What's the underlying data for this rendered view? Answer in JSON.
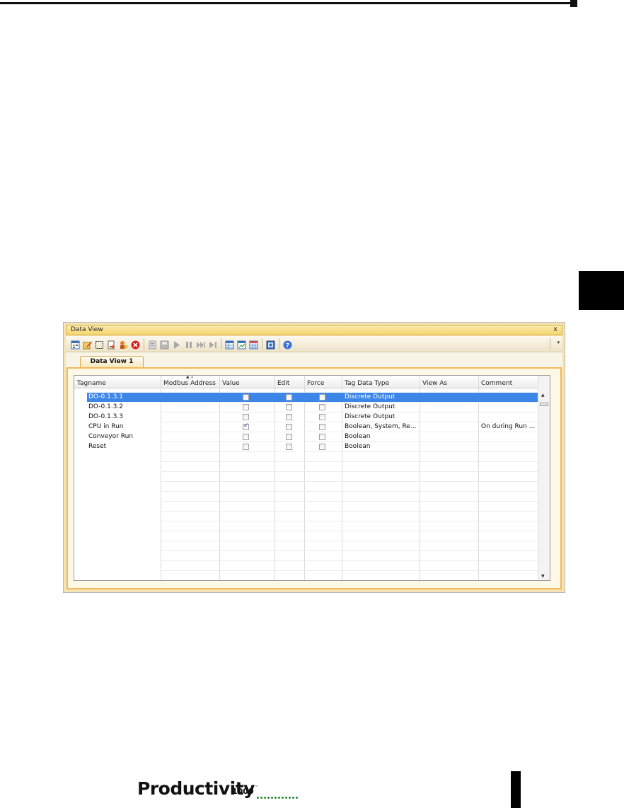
{
  "window": {
    "title": "Data View",
    "close_label": "x",
    "tab_label": "Data View 1"
  },
  "toolbar": {
    "icons": [
      "add-tag-icon",
      "edit-tag-icon",
      "select-icon",
      "import-icon",
      "user-icon",
      "remove-icon",
      "write-icon",
      "save-icon",
      "play-icon",
      "pause-icon",
      "step-forward-icon",
      "step-end-icon",
      "table-view-icon",
      "chart-view-icon",
      "grid-view-icon",
      "monitor-icon",
      "help-icon"
    ],
    "dropdown_label": "▾"
  },
  "grid": {
    "columns": [
      "Tagname",
      "Modbus Address",
      "Value",
      "Edit",
      "Force",
      "Tag Data Type",
      "View As",
      "Comment"
    ],
    "sort_indicator": "▲ 1",
    "rows": [
      {
        "tagname": "DO-0.1.3.1",
        "value_checked": false,
        "data_type": "Discrete Output",
        "comment": ""
      },
      {
        "tagname": "DO-0.1.3.2",
        "value_checked": false,
        "data_type": "Discrete Output",
        "comment": ""
      },
      {
        "tagname": "DO-0.1.3.3",
        "value_checked": false,
        "data_type": "Discrete Output",
        "comment": ""
      },
      {
        "tagname": "CPU in Run",
        "value_checked": true,
        "data_type": "Boolean, System, Re...",
        "comment": "On during Run ..."
      },
      {
        "tagname": "Conveyor Run",
        "value_checked": false,
        "data_type": "Boolean",
        "comment": ""
      },
      {
        "tagname": "Reset",
        "value_checked": false,
        "data_type": "Boolean",
        "comment": ""
      }
    ]
  },
  "footer": {
    "logo_word": "Productivity",
    "logo_number": "1000",
    "logo_tm": "™"
  },
  "colors": {
    "selection": "#3c86e8",
    "frame_accent": "#f0b95a",
    "titlebar": "#f5d56f",
    "logo_dots": "#1d8a2f"
  }
}
